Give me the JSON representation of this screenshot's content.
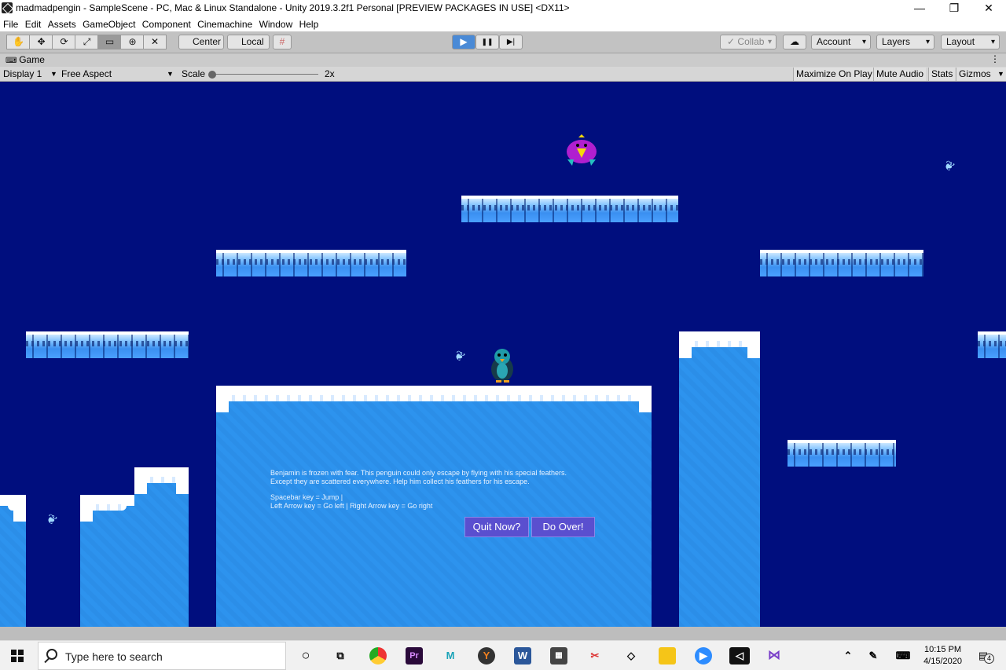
{
  "window": {
    "title": "madmadpengin - SampleScene - PC, Mac & Linux Standalone - Unity 2019.3.2f1 Personal [PREVIEW PACKAGES IN USE] <DX11>",
    "minimize": "—",
    "restore": "❐",
    "close": "✕"
  },
  "menu": [
    "File",
    "Edit",
    "Assets",
    "GameObject",
    "Component",
    "Cinemachine",
    "Window",
    "Help"
  ],
  "toolbar": {
    "tools": [
      "✋",
      "✥",
      "⟳",
      "⤢",
      "▭",
      "⊛",
      "✕"
    ],
    "center_label": "Center",
    "local_label": "Local",
    "play": "▶",
    "pause": "❚❚",
    "step": "▶|",
    "collab_label": "Collab",
    "account_label": "Account",
    "layers_label": "Layers",
    "layout_label": "Layout"
  },
  "game_tab": {
    "label": "Game",
    "display_label": "Display 1",
    "aspect_label": "Free Aspect",
    "scale_label": "Scale",
    "scale_value": "2x",
    "scale_level": 0.0,
    "maximize_label": "Maximize On Play",
    "mute_label": "Mute Audio",
    "stats_label": "Stats",
    "gizmos_label": "Gizmos"
  },
  "game": {
    "message_lines": [
      "Benjamin is frozen with fear. This penguin could only escape by flying with his special feathers.",
      "Except they are scattered everywhere. Help him collect his feathers for his escape.",
      "",
      "Spacebar key = Jump |",
      "Left Arrow key = Go left | Right Arrow key = Go right"
    ],
    "quit_button": "Quit Now?",
    "redo_button": "Do Over!",
    "feather_glyph": "❦"
  },
  "taskbar": {
    "search_placeholder": "Type here to search",
    "time": "10:15 PM",
    "date": "4/15/2020",
    "notifications": "4"
  },
  "colors": {
    "game_background": "#000e7e",
    "ice": "#2b8ee8",
    "button": "#5a4fcf",
    "enemy": "#b01fcf",
    "penguin": "#1f9aa8"
  }
}
